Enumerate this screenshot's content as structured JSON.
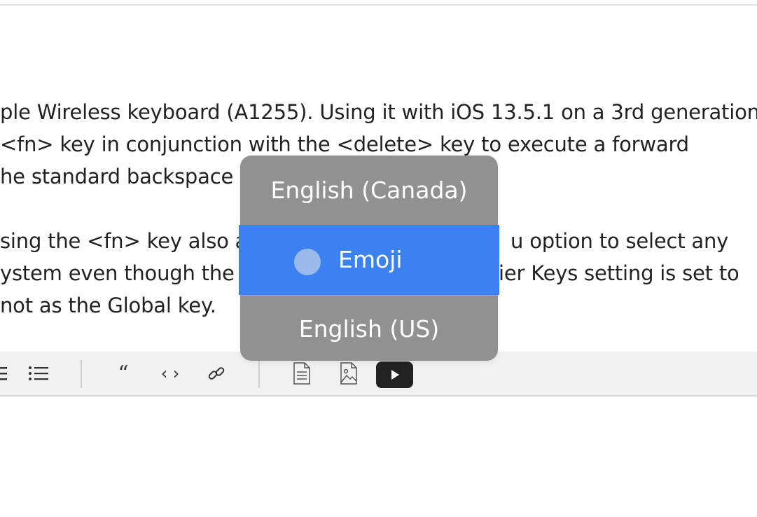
{
  "document": {
    "lines": [
      "ple Wireless keyboard (A1255). Using it with iOS 13.5.1 on a 3rd generation",
      " <fn> key in conjunction with the <delete> key to execute a forward",
      "he standard backspace b",
      "sing the <fn> key also a",
      "u option to select any",
      "ystem even though the",
      "ier Keys setting is set to",
      "not as the Global key."
    ]
  },
  "language_menu": {
    "items": [
      {
        "label": "English (Canada)",
        "selected": false
      },
      {
        "label": "Emoji",
        "selected": true
      },
      {
        "label": "English (US)",
        "selected": false
      }
    ]
  },
  "toolbar": {
    "buttons": [
      {
        "icon": "numbered-list-icon"
      },
      {
        "icon": "bullet-list-icon"
      },
      {
        "icon": "quote-icon",
        "glyph": "“"
      },
      {
        "icon": "code-icon",
        "glyph": "‹ ›"
      },
      {
        "icon": "link-icon"
      },
      {
        "icon": "document-icon"
      },
      {
        "icon": "image-icon"
      },
      {
        "icon": "video-icon"
      }
    ]
  },
  "colors": {
    "menu_background": "#919191",
    "menu_selected": "#3b82f0",
    "toolbar_background": "#f1f1f1"
  }
}
